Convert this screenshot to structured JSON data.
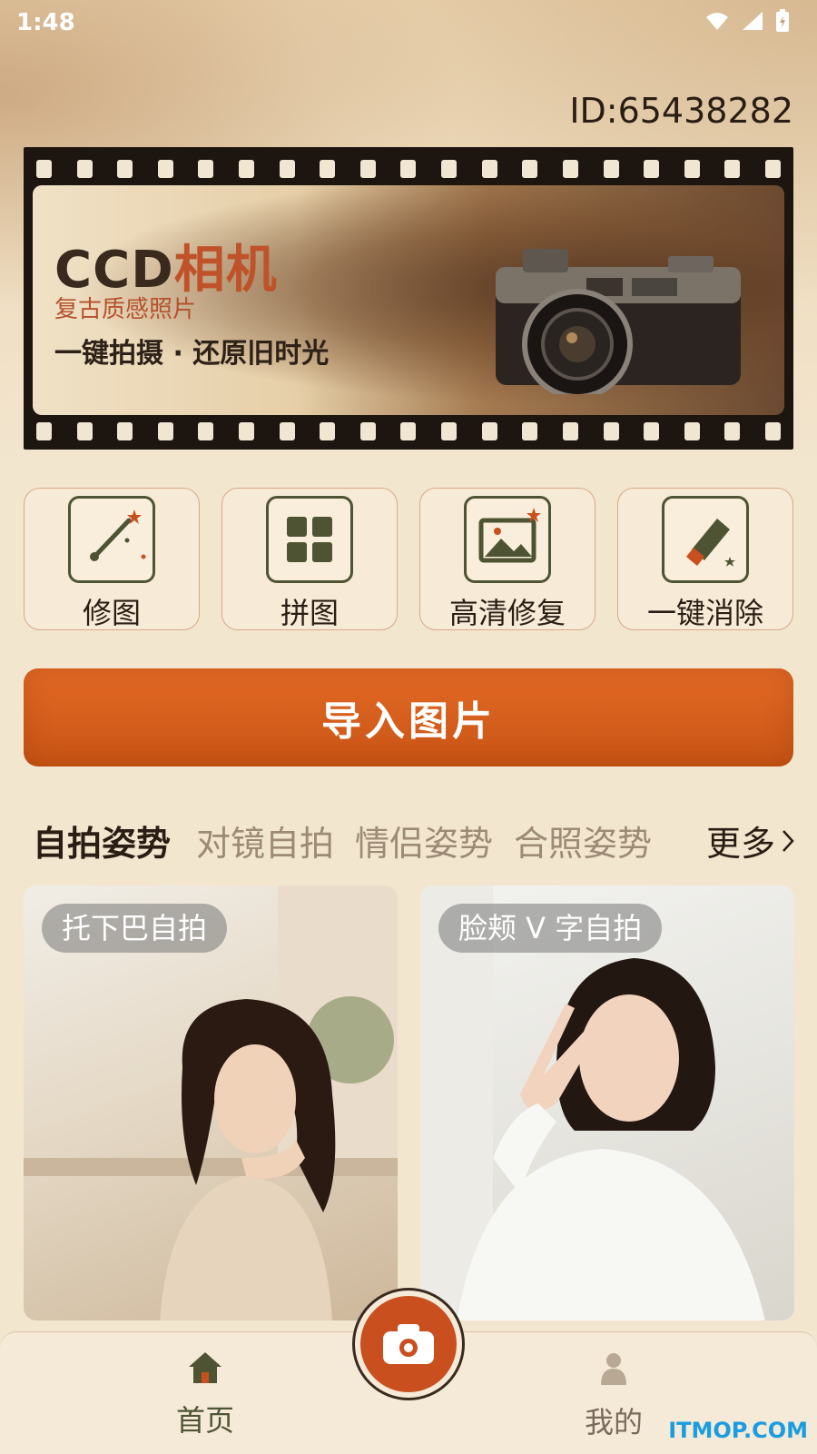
{
  "status_bar": {
    "time": "1:48"
  },
  "user": {
    "id_text": "ID:65438282"
  },
  "banner": {
    "title_prefix": "CCD",
    "title_accent": "相机",
    "subtitle": "复古质感照片",
    "description": "一键拍摄 · 还原旧时光"
  },
  "tools": [
    {
      "label": "修图",
      "icon": "magic-wand-icon"
    },
    {
      "label": "拼图",
      "icon": "grid-icon"
    },
    {
      "label": "高清修复",
      "icon": "image-icon"
    },
    {
      "label": "一键消除",
      "icon": "eraser-icon"
    }
  ],
  "import_button": {
    "label": "导入图片"
  },
  "pose_tabs": {
    "items": [
      "自拍姿势",
      "对镜自拍",
      "情侣姿势",
      "合照姿势"
    ],
    "active_index": 0,
    "more_label": "更多"
  },
  "cards": [
    {
      "tag": "托下巴自拍"
    },
    {
      "tag": "脸颊 V 字自拍"
    }
  ],
  "bottom_nav": {
    "home_label": "首页",
    "mine_label": "我的",
    "center_icon": "camera-icon"
  },
  "watermark": "ITMOP.COM",
  "colors": {
    "accent": "#c94f1e",
    "olive": "#4e5433",
    "background": "#f3e6cf"
  }
}
